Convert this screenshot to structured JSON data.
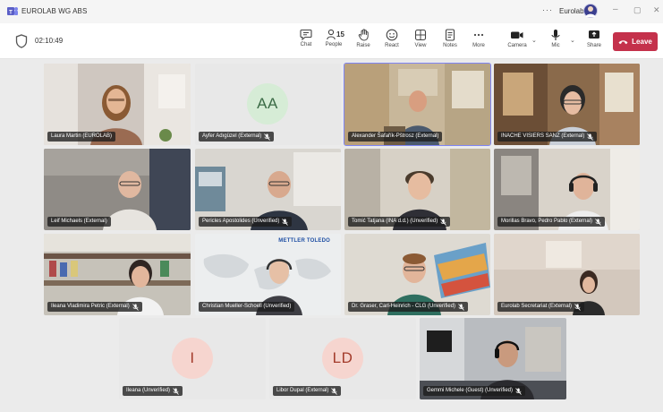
{
  "window": {
    "title": "EUROLAB WG ABS",
    "more": "···",
    "org_name": "Eurolab",
    "minimize": "–",
    "maximize": "▢",
    "close": "✕"
  },
  "toolbar": {
    "timer": "02:10:49",
    "people_count": "15",
    "buttons": [
      {
        "label": "Chat",
        "icon": "chat-icon"
      },
      {
        "label": "People",
        "icon": "people-icon"
      },
      {
        "label": "Raise",
        "icon": "raise-hand-icon"
      },
      {
        "label": "React",
        "icon": "react-icon"
      },
      {
        "label": "View",
        "icon": "view-icon"
      },
      {
        "label": "Notes",
        "icon": "notes-icon"
      },
      {
        "label": "More",
        "icon": "more-icon"
      },
      {
        "label": "Camera",
        "icon": "camera-icon"
      },
      {
        "label": "Mic",
        "icon": "mic-icon"
      },
      {
        "label": "Share",
        "icon": "share-icon"
      }
    ],
    "leave_label": "Leave",
    "colors": {
      "leave": "#c4314b",
      "active_speaker": "#7f85f5"
    }
  },
  "participants": [
    {
      "name": "Laura Martin (EUROLAB)",
      "video": true,
      "muted": false
    },
    {
      "name": "Ayfer Adıgüzel (External)",
      "video": false,
      "initials": "AA",
      "muted": true,
      "avatar_bg": "#d6ecd6",
      "avatar_fg": "#3b6b46"
    },
    {
      "name": "Alexander Šafařík-Pštrosz (External)",
      "video": true,
      "muted": false,
      "active": true
    },
    {
      "name": "INACHE VISIERS SANZ (External)",
      "video": true,
      "muted": true
    },
    {
      "name": "Leif Michaels (External)",
      "video": true,
      "muted": false
    },
    {
      "name": "Pericles Apostolides (Unverified)",
      "video": true,
      "muted": true
    },
    {
      "name": "Tomić Tatjana (INA d.d.) (Unverified)",
      "video": true,
      "muted": true
    },
    {
      "name": "Morillas Bravo, Pedro Pablo (External)",
      "video": true,
      "muted": true
    },
    {
      "name": "Ileana Vladimira Petric (External)",
      "video": true,
      "muted": true
    },
    {
      "name": "Christian Mueller-Schoell (Unverified)",
      "video": true,
      "muted": false,
      "background_text": "METTLER TOLEDO"
    },
    {
      "name": "Dr. Graser, Carl-Heinrich - CLG (Unverified)",
      "video": true,
      "muted": true
    },
    {
      "name": "Eurolab Secretariat (External)",
      "video": true,
      "muted": true
    },
    {
      "name": "Ileana (Unverified)",
      "video": false,
      "initials": "I",
      "muted": true,
      "avatar_bg": "#f6d5cf",
      "avatar_fg": "#a33b2b"
    },
    {
      "name": "Libor Dupal (External)",
      "video": false,
      "initials": "LD",
      "muted": true,
      "avatar_bg": "#f6d5cf",
      "avatar_fg": "#a33b2b"
    },
    {
      "name": "Gemmi Michele (Guest) (Unverified)",
      "video": true,
      "muted": true
    }
  ]
}
